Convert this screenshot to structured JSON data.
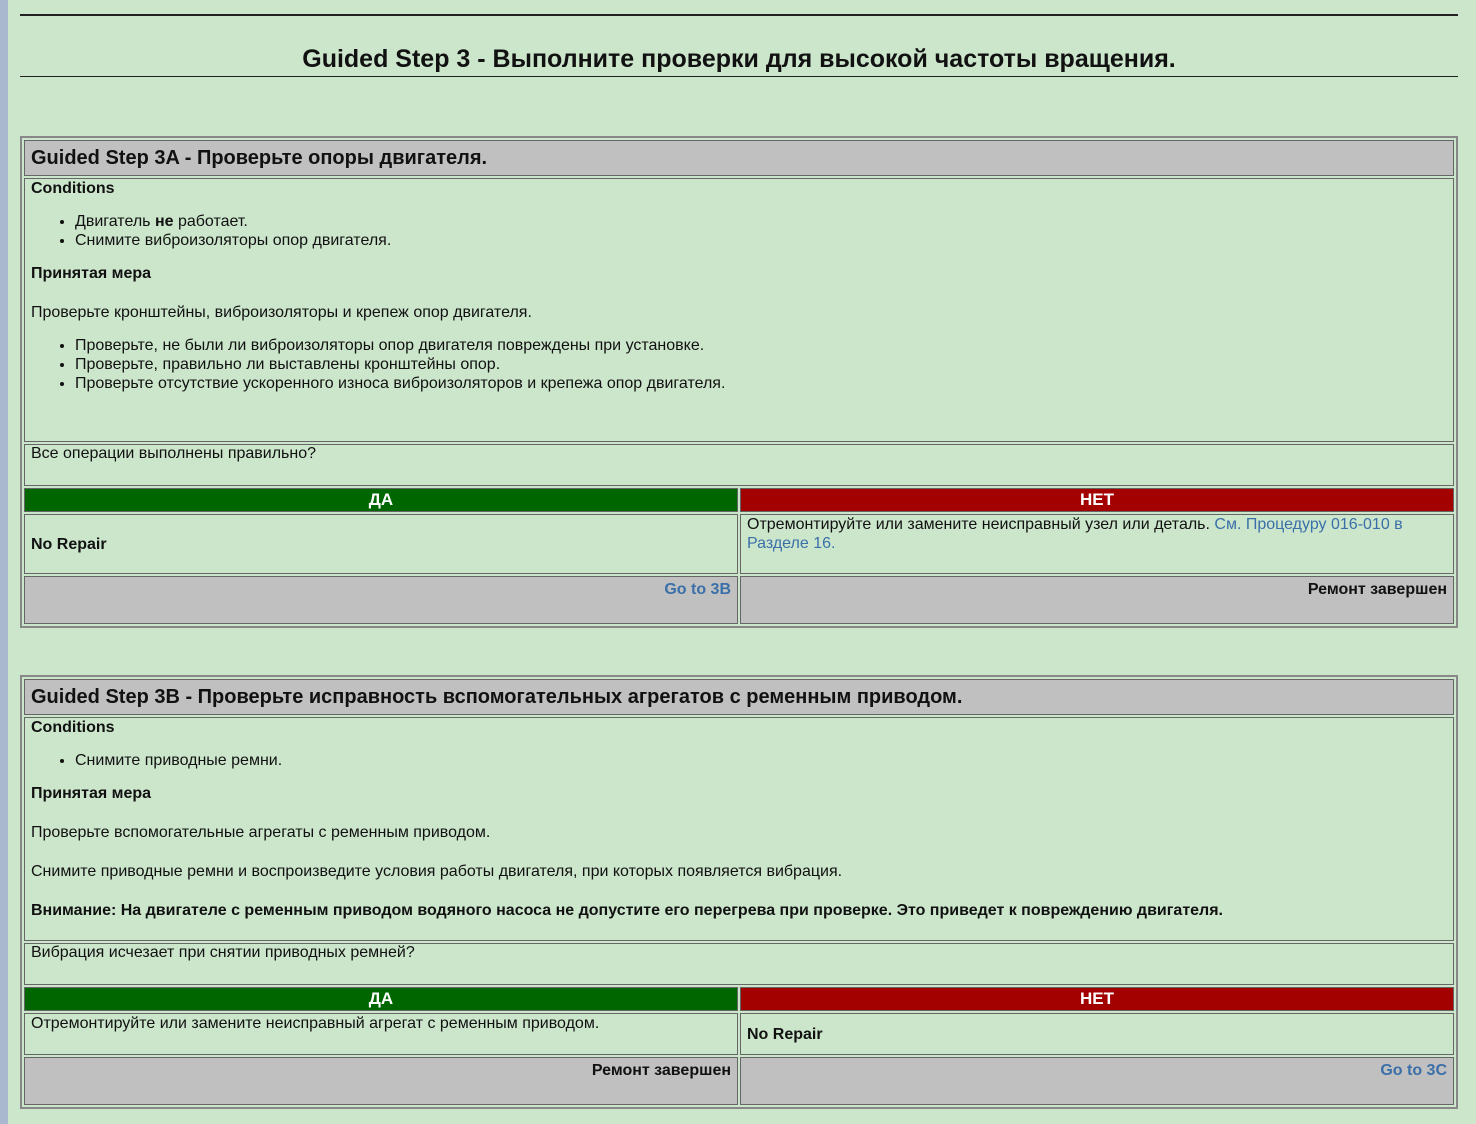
{
  "page_title": "Guided Step 3 - Выполните проверки для высокой частоты вращения.",
  "steps": [
    {
      "title": "Guided Step 3A - Проверьте опоры двигателя.",
      "conditions_label": "Conditions",
      "conditions": [
        "Снимите виброизоляторы опор двигателя."
      ],
      "condition1_pre": "Двигатель ",
      "condition1_bold": "не",
      "condition1_post": " работает.",
      "action_label": "Принятая мера",
      "action_text": "Проверьте кронштейны, виброизоляторы и крепеж опор двигателя.",
      "checks": [
        "Проверьте, не были ли виброизоляторы опор двигателя повреждены при установке.",
        "Проверьте, правильно ли выставлены кронштейны опор.",
        "Проверьте отсутствие ускоренного износа виброизоляторов и крепежа опор двигателя."
      ],
      "question": "Все операции выполнены правильно?",
      "yes_label": "ДА",
      "no_label": "НЕТ",
      "yes_result": "No Repair",
      "no_result_text": "Отремонтируйте или замените неисправный узел или деталь. ",
      "no_result_link": "См. Процедуру 016-010 в Разделе 16.",
      "yes_footer": "Go to 3B",
      "no_footer": "Ремонт завершен"
    },
    {
      "title": "Guided Step 3B - Проверьте исправность вспомогательных агрегатов с ременным приводом.",
      "conditions_label": "Conditions",
      "conditions": [
        "Снимите приводные ремни."
      ],
      "action_label": "Принятая мера",
      "action_text": "Проверьте вспомогательные агрегаты с ременным приводом.",
      "action_text2": "Снимите приводные ремни и воспроизведите условия работы двигателя, при которых появляется вибрация.",
      "warning": "Внимание: На двигателе с ременным приводом водяного насоса не допустите его перегрева при проверке. Это приведет к повреждению двигателя.",
      "question": "Вибрация исчезает при снятии приводных ремней?",
      "yes_label": "ДА",
      "no_label": "НЕТ",
      "yes_result": "Отремонтируйте или замените неисправный агрегат с ременным приводом.",
      "no_result": "No Repair",
      "yes_footer": "Ремонт завершен",
      "no_footer": "Go to 3C"
    }
  ]
}
